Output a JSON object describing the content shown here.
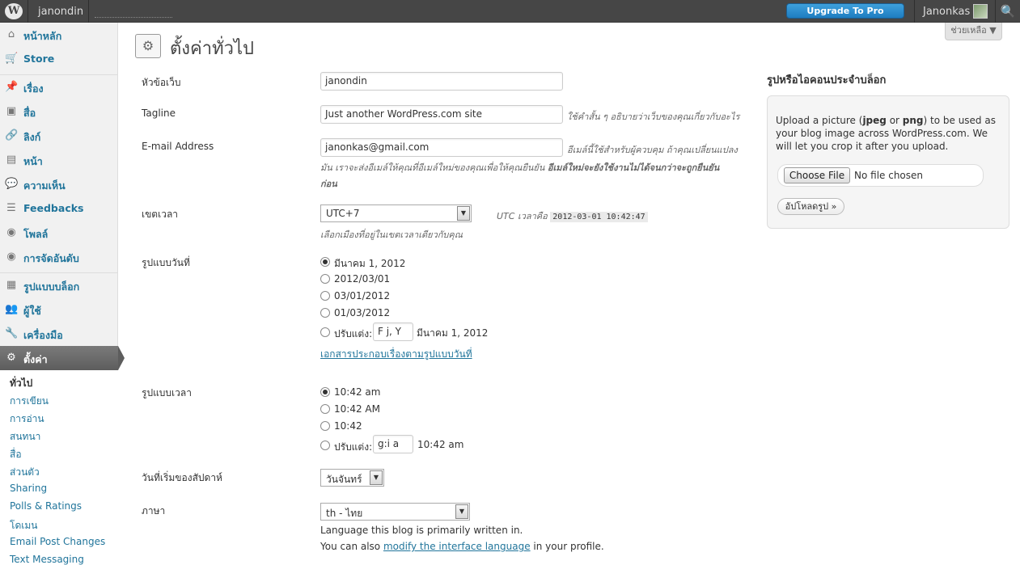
{
  "adminbar": {
    "logo": "W",
    "blog_name": "janondin",
    "upgrade_label": "Upgrade To Pro",
    "username": "Janonkas",
    "search_icon": "🔍"
  },
  "sidebar": {
    "items": [
      {
        "label": "หน้าหลัก",
        "icon": "⌂"
      },
      {
        "label": "Store",
        "icon": "🛒"
      },
      {
        "label": "เรื่อง",
        "icon": "📌"
      },
      {
        "label": "สื่อ",
        "icon": "▣"
      },
      {
        "label": "ลิงก์",
        "icon": "🔗"
      },
      {
        "label": "หน้า",
        "icon": "▤"
      },
      {
        "label": "ความเห็น",
        "icon": "💬"
      },
      {
        "label": "Feedbacks",
        "icon": "☰"
      },
      {
        "label": "โพลล์",
        "icon": "◉"
      },
      {
        "label": "การจัดอันดับ",
        "icon": "◉"
      },
      {
        "label": "รูปแบบบล็อก",
        "icon": "▦"
      },
      {
        "label": "ผู้ใช้",
        "icon": "👥"
      },
      {
        "label": "เครื่องมือ",
        "icon": "🔧"
      },
      {
        "label": "ตั้งค่า",
        "icon": "⚙"
      }
    ],
    "submenu": [
      "ทั่วไป",
      "การเขียน",
      "การอ่าน",
      "สนทนา",
      "สื่อ",
      "ส่วนตัว",
      "Sharing",
      "Polls & Ratings",
      "โดเมน",
      "Email Post Changes",
      "Text Messaging"
    ]
  },
  "header": {
    "title": "ตั้งค่าทั่วไป",
    "help_label": "ช่วยเหลือ ▼"
  },
  "form": {
    "site_title": {
      "label": "หัวข้อเว็บ",
      "value": "janondin"
    },
    "tagline": {
      "label": "Tagline",
      "value": "Just another WordPress.com site",
      "desc": "ใช้คำสั้น ๆ อธิบายว่าเว็บของคุณเกี่ยวกับอะไร"
    },
    "email": {
      "label": "E-mail Address",
      "value": "janonkas@gmail.com",
      "desc_line1": "อีเมล์นี้ใช้สำหรับผู้ควบคุม ถ้าคุณเปลี่ยนแปลง",
      "desc_line2a": "มัน เราจะส่งอีเมล์ให้คุณที่อีเมล์ใหม่ของคุณเพื่อให้คุณยืนยัน",
      "desc_line2b": "อีเมล์ใหม่จะยังใช้งานไม่ได้จนกว่าจะถูกยืนยัน",
      "desc_line3": "ก่อน"
    },
    "timezone": {
      "label": "เขตเวลา",
      "value": "UTC+7",
      "utc_label": "UTC เวลาคือ",
      "utc_time": "2012-03-01 10:42:47",
      "desc": "เลือกเมืองที่อยู่ในเขตเวลาเดียวกับคุณ"
    },
    "date_format": {
      "label": "รูปแบบวันที่",
      "options": [
        "มีนาคม 1, 2012",
        "2012/03/01",
        "03/01/2012",
        "01/03/2012"
      ],
      "custom_label": "ปรับแต่ง:",
      "custom_value": "F j, Y",
      "custom_preview": "มีนาคม 1, 2012",
      "doc_link": "เอกสารประกอบเรื่องตามรูปแบบวันที่"
    },
    "time_format": {
      "label": "รูปแบบเวลา",
      "options": [
        "10:42 am",
        "10:42 AM",
        "10:42"
      ],
      "custom_label": "ปรับแต่ง:",
      "custom_value": "g:i a",
      "custom_preview": "10:42 am"
    },
    "week_start": {
      "label": "วันที่เริ่มของสัปดาห์",
      "value": "วันจันทร์"
    },
    "language": {
      "label": "ภาษา",
      "value": "th - ไทย",
      "desc1": "Language this blog is primarily written in.",
      "desc2a": "You can also ",
      "desc2_link": "modify the interface language",
      "desc2b": " in your profile."
    }
  },
  "widget": {
    "title": "รูปหรือไอคอนประจำบล็อก",
    "text_a": "Upload a picture (",
    "text_jpeg": "jpeg",
    "text_or": " or ",
    "text_png": "png",
    "text_b": ") to be used as your blog image across WordPress.com. We will let you crop it after you upload.",
    "choose_file": "Choose File",
    "no_file": "No file chosen",
    "upload_btn": "อัปโหลดรูป »"
  }
}
